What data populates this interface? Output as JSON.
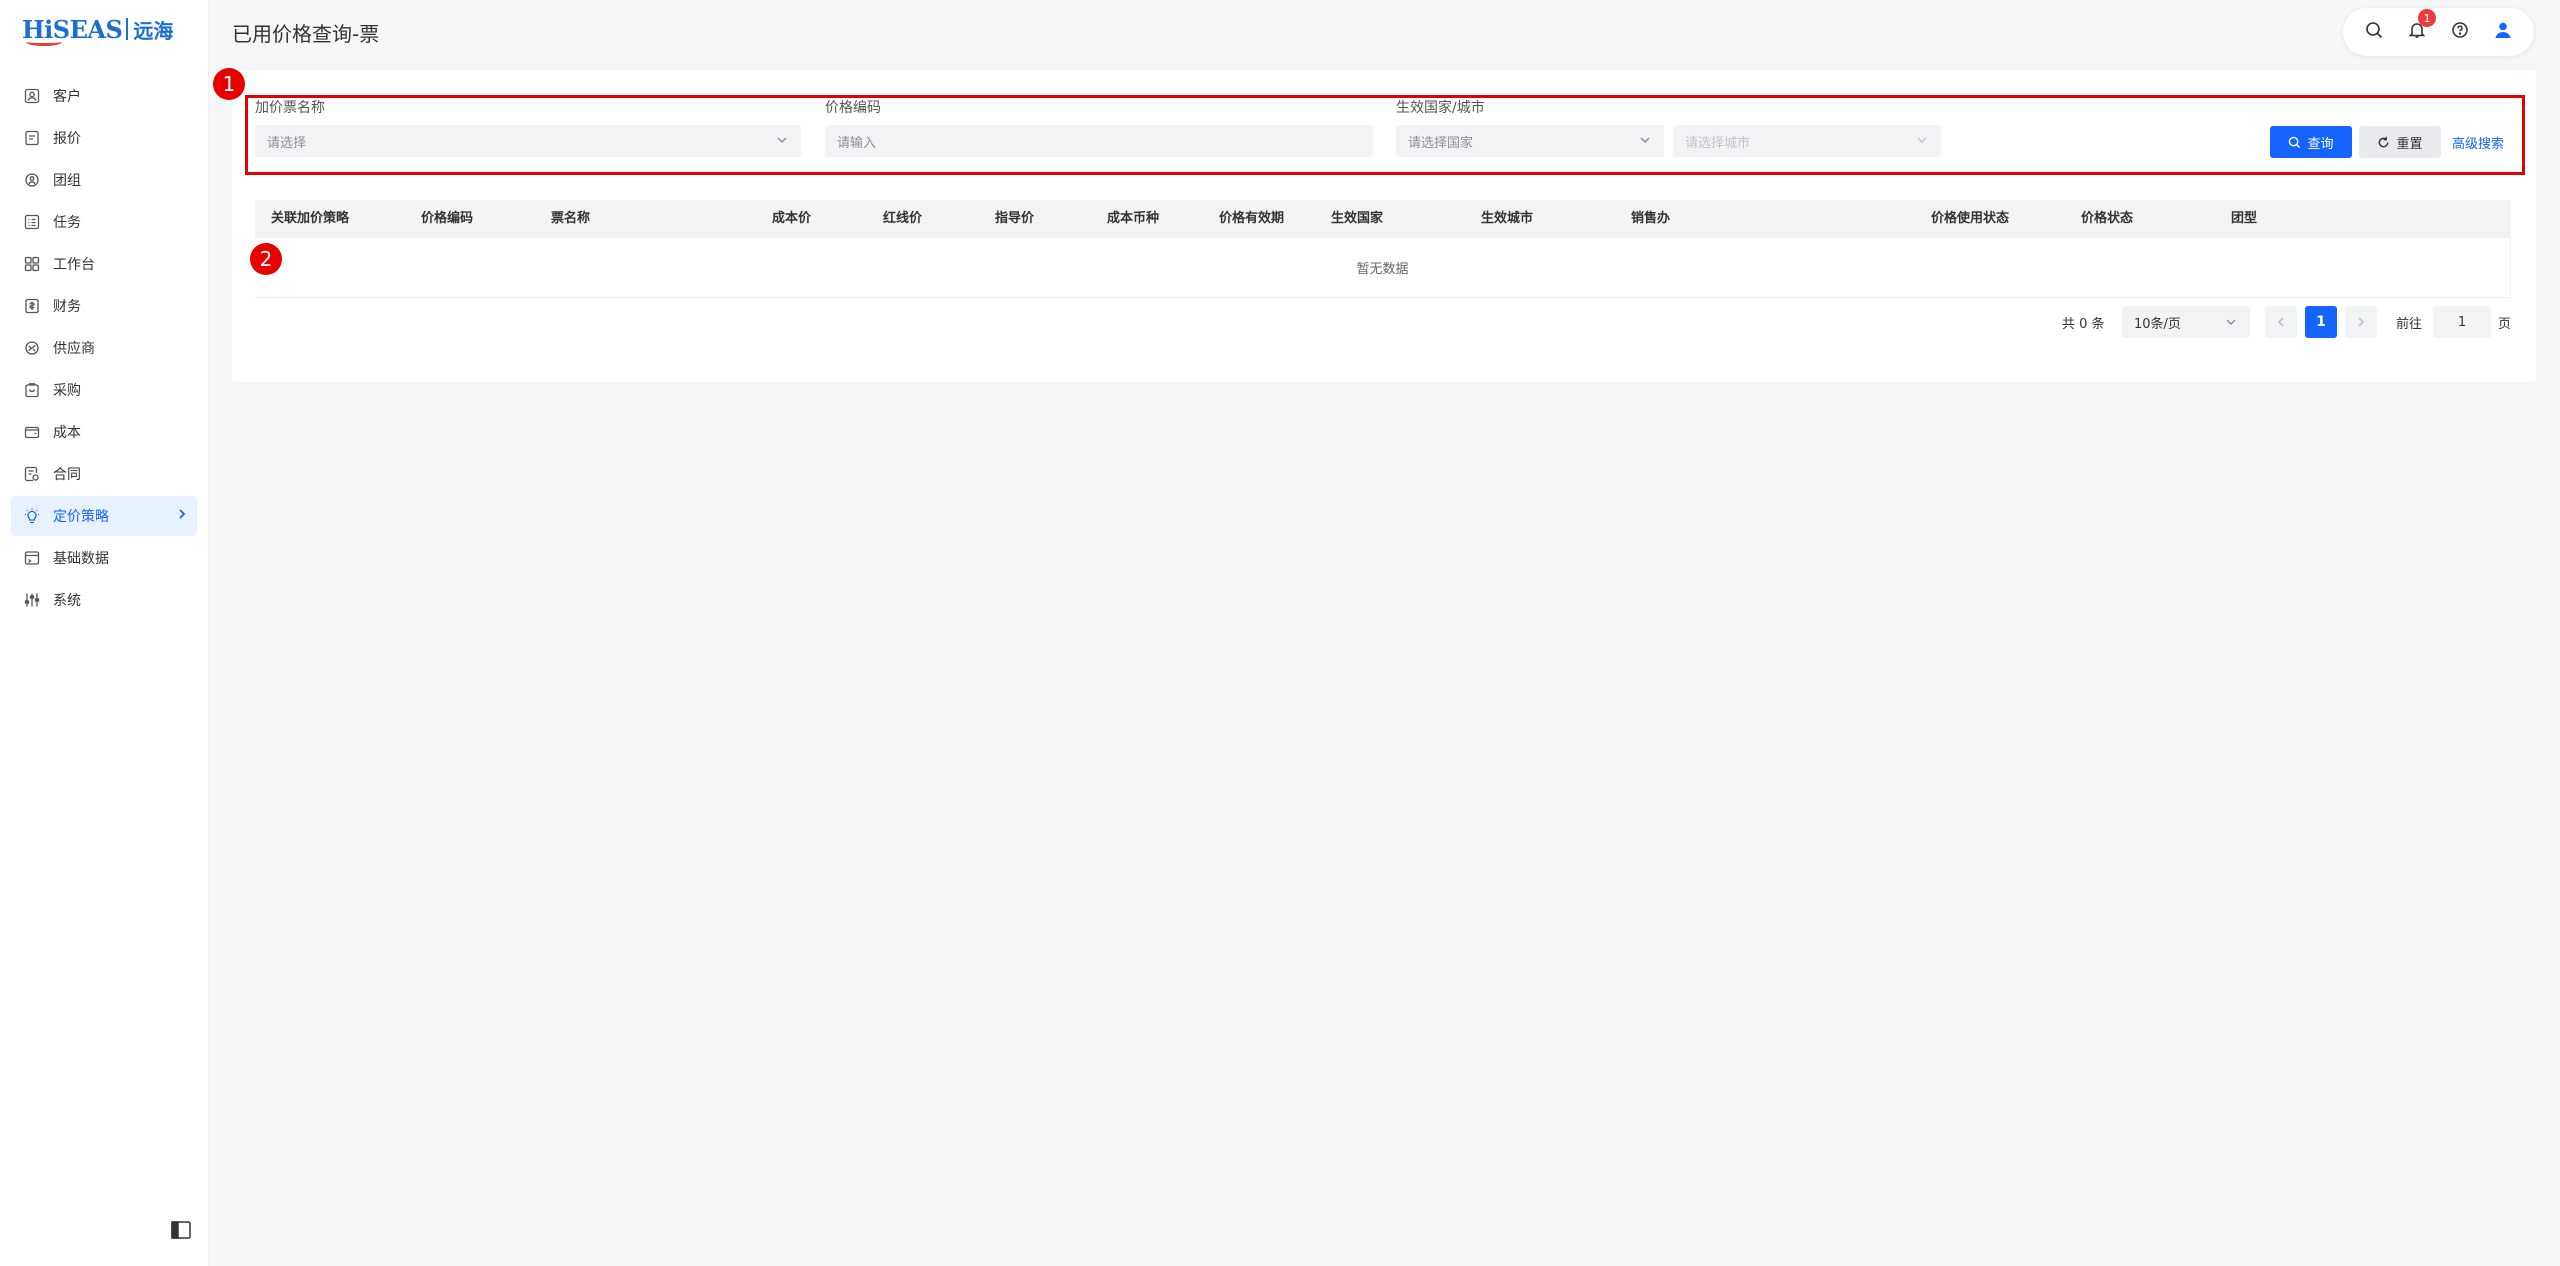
{
  "app": {
    "logo_text": "HiSEAS",
    "logo_cn": "远海"
  },
  "sidebar": {
    "items": [
      {
        "label": "客户",
        "icon": "customer-icon"
      },
      {
        "label": "报价",
        "icon": "quote-icon"
      },
      {
        "label": "团组",
        "icon": "group-icon"
      },
      {
        "label": "任务",
        "icon": "task-icon"
      },
      {
        "label": "工作台",
        "icon": "workbench-icon"
      },
      {
        "label": "财务",
        "icon": "finance-icon"
      },
      {
        "label": "供应商",
        "icon": "supplier-icon"
      },
      {
        "label": "采购",
        "icon": "purchase-icon"
      },
      {
        "label": "成本",
        "icon": "wallet-icon"
      },
      {
        "label": "合同",
        "icon": "contract-icon"
      },
      {
        "label": "定价策略",
        "icon": "lightbulb-icon",
        "active": true
      },
      {
        "label": "基础数据",
        "icon": "database-icon"
      },
      {
        "label": "系统",
        "icon": "sliders-icon"
      }
    ]
  },
  "header": {
    "title": "已用价格查询-票",
    "notification_count": "1"
  },
  "filters": {
    "ticket_name": {
      "label": "加价票名称",
      "placeholder": "请选择"
    },
    "price_code": {
      "label": "价格编码",
      "placeholder": "请输入"
    },
    "country_city": {
      "label": "生效国家/城市",
      "country_placeholder": "请选择国家",
      "city_placeholder": "请选择城市"
    },
    "query_label": "查询",
    "reset_label": "重置",
    "advanced_label": "高级搜索"
  },
  "table": {
    "columns": [
      "关联加价策略",
      "价格编码",
      "票名称",
      "成本价",
      "红线价",
      "指导价",
      "成本币种",
      "价格有效期",
      "生效国家",
      "生效城市",
      "销售办",
      "价格使用状态",
      "价格状态",
      "团型"
    ],
    "empty_text": "暂无数据"
  },
  "pagination": {
    "total_text": "共 0 条",
    "page_size": "10条/页",
    "current_page": "1",
    "goto_label": "前往",
    "goto_value": "1",
    "page_suffix": "页"
  },
  "annotations": {
    "marker1": "1",
    "marker2": "2"
  },
  "colors": {
    "primary": "#1664ff",
    "highlight": "#e60000",
    "badge": "#ee3b3b"
  }
}
